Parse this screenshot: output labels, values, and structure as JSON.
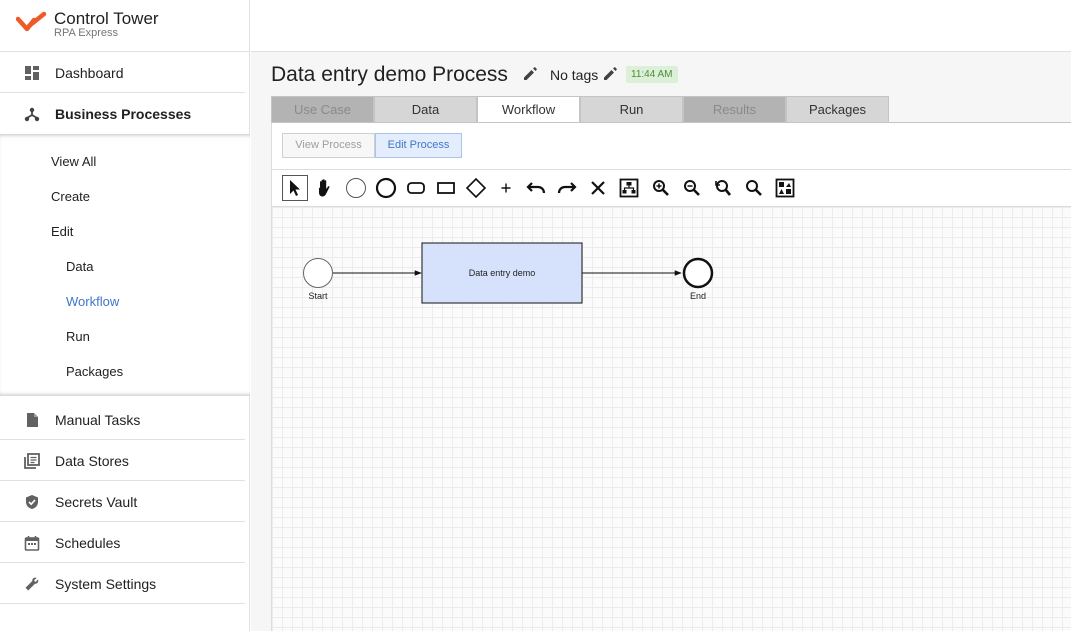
{
  "app": {
    "title": "Control Tower",
    "subtitle": "RPA Express",
    "brand_color": "#f05a28"
  },
  "sidebar": {
    "items": [
      {
        "label": "Dashboard",
        "icon": "dashboard-icon"
      },
      {
        "label": "Business Processes",
        "icon": "process-icon",
        "expanded": true
      },
      {
        "label": "Manual Tasks",
        "icon": "file-icon"
      },
      {
        "label": "Data Stores",
        "icon": "library-icon"
      },
      {
        "label": "Secrets Vault",
        "icon": "shield-icon"
      },
      {
        "label": "Schedules",
        "icon": "calendar-icon"
      },
      {
        "label": "System Settings",
        "icon": "wrench-icon"
      }
    ],
    "sub_items": {
      "view_all": "View All",
      "create": "Create",
      "edit": "Edit",
      "data": "Data",
      "workflow": "Workflow",
      "run": "Run",
      "packages": "Packages"
    },
    "active_sub": "Workflow",
    "active_color": "#3f76c9"
  },
  "process": {
    "title": "Data entry demo Process",
    "tags_label": "No tags",
    "time": "11:44 AM"
  },
  "tabs": [
    {
      "label": "Use Case",
      "state": "disabled"
    },
    {
      "label": "Data",
      "state": "normal"
    },
    {
      "label": "Workflow",
      "state": "active"
    },
    {
      "label": "Run",
      "state": "normal"
    },
    {
      "label": "Results",
      "state": "disabled"
    },
    {
      "label": "Packages",
      "state": "normal"
    }
  ],
  "mode_buttons": {
    "view": "View Process",
    "edit": "Edit Process",
    "selected": "Edit Process"
  },
  "toolbar": {
    "tools": [
      "pointer-icon",
      "hand-icon",
      "start-event-icon",
      "end-event-icon",
      "task-icon",
      "subprocess-icon",
      "gateway-icon",
      "plus-icon",
      "undo-icon",
      "redo-icon",
      "delete-icon",
      "auto-layout-icon",
      "zoom-in-icon",
      "zoom-out-icon",
      "zoom-reset-icon",
      "zoom-fit-icon",
      "export-image-icon"
    ],
    "selected": "pointer-icon"
  },
  "diagram": {
    "start_label": "Start",
    "task_label": "Data entry demo",
    "end_label": "End",
    "task_fill": "#d6e2fc"
  }
}
